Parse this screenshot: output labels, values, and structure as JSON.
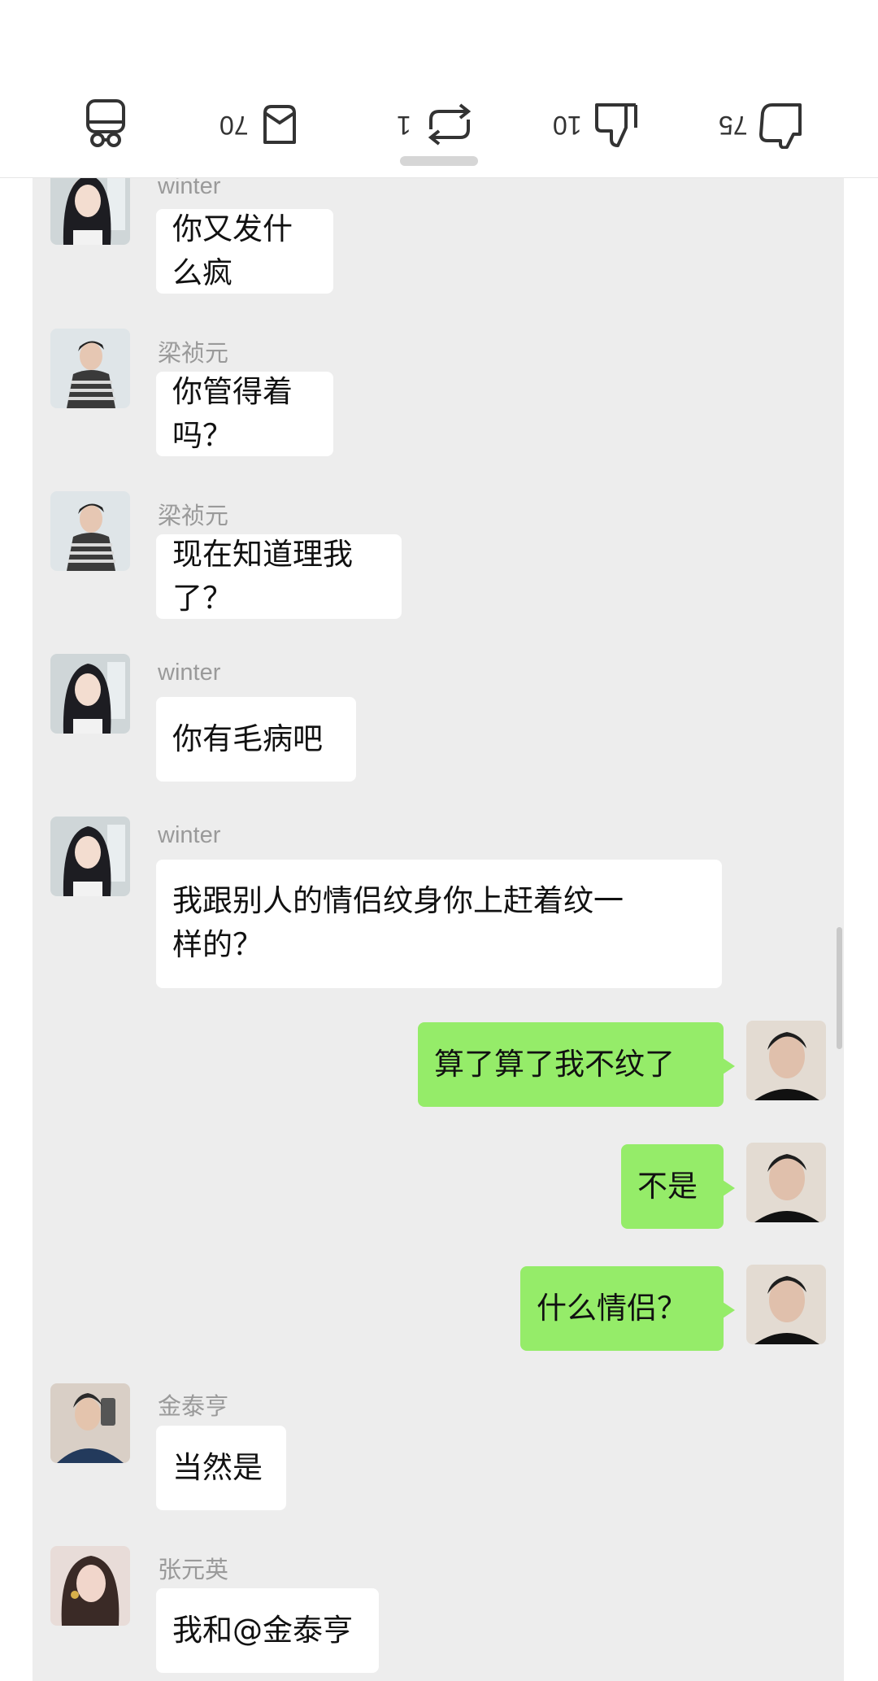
{
  "toolbar": {
    "share_count": "70",
    "repost_count": "1",
    "dislike_count": "10",
    "like_count": "75"
  },
  "messages": [
    {
      "sender": "winter",
      "text": "你又发什么疯"
    },
    {
      "sender": "梁祯元",
      "text": "你管得着吗？"
    },
    {
      "sender": "梁祯元",
      "text": "现在知道理我了？"
    },
    {
      "sender": "winter",
      "text": "你有毛病吧"
    },
    {
      "sender": "winter",
      "line1": "我跟别人的情侣纹身你上赶着纹一",
      "line2": "样的？"
    },
    {
      "sender": "",
      "text": "算了算了我不纹了"
    },
    {
      "sender": "",
      "text": "不是"
    },
    {
      "sender": "",
      "text": "什么情侣？"
    },
    {
      "sender": "金泰亨",
      "text": "当然是"
    },
    {
      "sender": "张元英",
      "text": "我和@金泰亨"
    }
  ],
  "colors": {
    "chat_bg": "#ededed",
    "self_bubble": "#95ec69",
    "other_bubble": "#ffffff"
  }
}
